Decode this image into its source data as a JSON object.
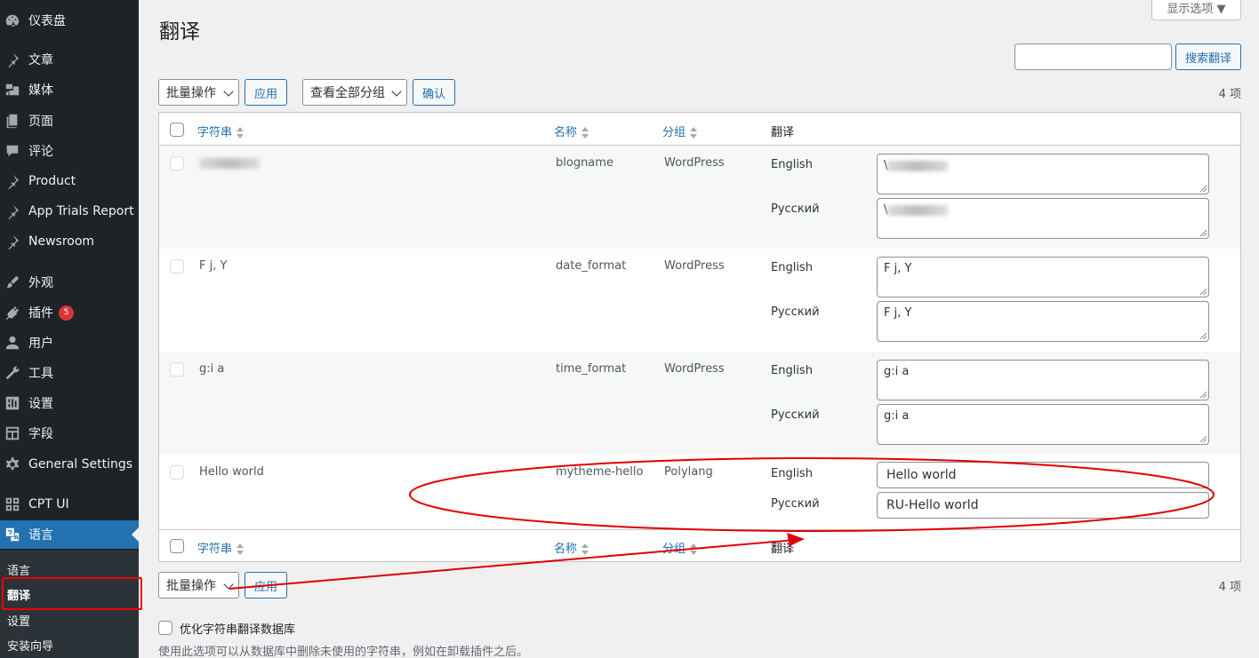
{
  "sidebar": {
    "items": [
      {
        "label": "仪表盘",
        "icon": "dashboard-icon"
      },
      {
        "label": "文章",
        "icon": "pin-icon"
      },
      {
        "label": "媒体",
        "icon": "media-icon"
      },
      {
        "label": "页面",
        "icon": "page-icon"
      },
      {
        "label": "评论",
        "icon": "comment-icon"
      },
      {
        "label": "Product",
        "icon": "pin-icon"
      },
      {
        "label": "App Trials Report",
        "icon": "pin-icon"
      },
      {
        "label": "Newsroom",
        "icon": "pin-icon"
      },
      {
        "label": "外观",
        "icon": "appearance-icon"
      },
      {
        "label": "插件",
        "icon": "plugin-icon",
        "badge": "5"
      },
      {
        "label": "用户",
        "icon": "user-icon"
      },
      {
        "label": "工具",
        "icon": "tools-icon"
      },
      {
        "label": "设置",
        "icon": "settings-icon"
      },
      {
        "label": "字段",
        "icon": "fields-icon"
      },
      {
        "label": "General Settings",
        "icon": "gear-icon"
      },
      {
        "label": "CPT UI",
        "icon": "grid-icon"
      },
      {
        "label": "语言",
        "icon": "translate-icon"
      }
    ],
    "submenu": [
      "语言",
      "翻译",
      "设置",
      "安装向导"
    ]
  },
  "header": {
    "title": "翻译",
    "screen_options": "显示选项 ▼",
    "search_button": "搜索翻译",
    "search_value": ""
  },
  "toolbar": {
    "bulk_action": "批量操作",
    "apply": "应用",
    "group_filter": "查看全部分组",
    "confirm": "确认",
    "count": "4 项"
  },
  "table": {
    "columns": {
      "string": "字符串",
      "name": "名称",
      "group": "分组",
      "translation": "翻译"
    },
    "rows": [
      {
        "string": "",
        "name": "blogname",
        "group": "WordPress",
        "translations": [
          {
            "lang": "English",
            "value": "\\"
          },
          {
            "lang": "Русский",
            "value": "\\"
          }
        ]
      },
      {
        "string": "F j, Y",
        "name": "date_format",
        "group": "WordPress",
        "translations": [
          {
            "lang": "English",
            "value": "F j, Y"
          },
          {
            "lang": "Русский",
            "value": "F j, Y"
          }
        ]
      },
      {
        "string": "g:i a",
        "name": "time_format",
        "group": "WordPress",
        "translations": [
          {
            "lang": "English",
            "value": "g:i a"
          },
          {
            "lang": "Русский",
            "value": "g:i a"
          }
        ]
      },
      {
        "string": "Hello world",
        "name": "mytheme-hello",
        "group": "Polylang",
        "translations": [
          {
            "lang": "English",
            "value": "Hello world"
          },
          {
            "lang": "Русский",
            "value": "RU-Hello world"
          }
        ]
      }
    ]
  },
  "bottom": {
    "bulk_action": "批量操作",
    "apply": "应用",
    "count": "4 项",
    "clean_label": "优化字符串翻译数据库",
    "clean_desc": "使用此选项可以从数据库中删除未使用的字符串，例如在卸载插件之后。"
  },
  "colors": {
    "sidebar_bg": "#1d2327",
    "accent": "#2271b1",
    "annotation": "#e00000"
  }
}
